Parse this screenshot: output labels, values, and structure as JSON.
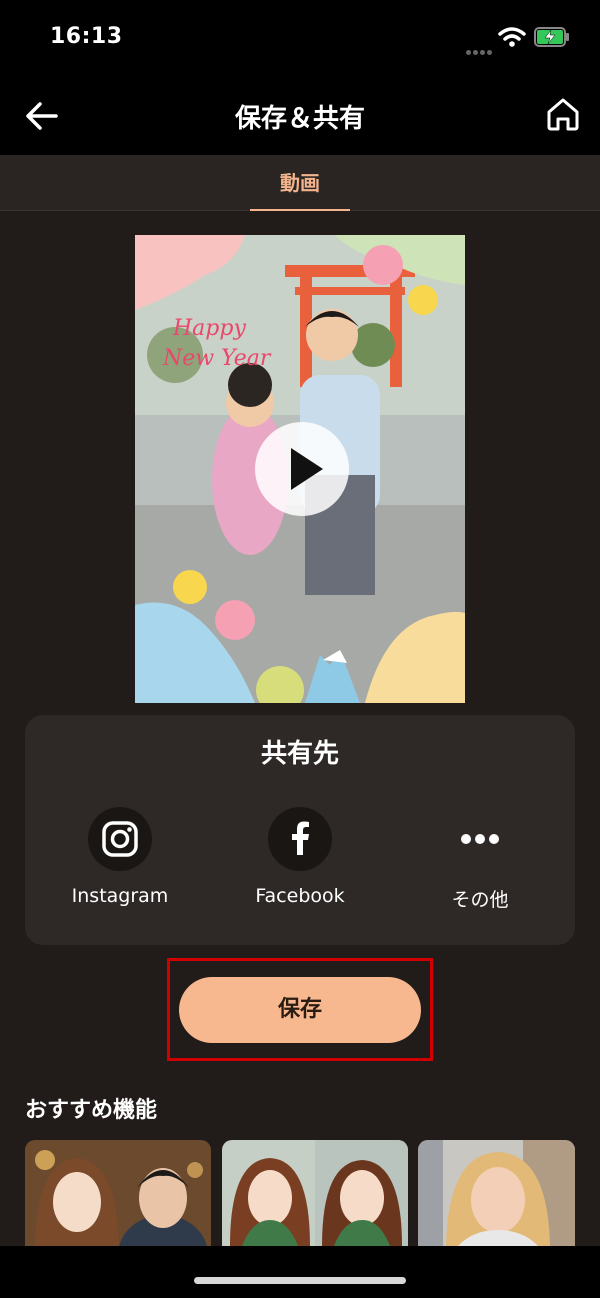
{
  "status_bar": {
    "time": "16:13"
  },
  "nav": {
    "title": "保存＆共有"
  },
  "tabs": [
    {
      "label": "動画",
      "active": true
    }
  ],
  "preview": {
    "greeting_line1": "Happy",
    "greeting_line2": "New Year"
  },
  "share": {
    "title": "共有先",
    "items": [
      {
        "label": "Instagram",
        "icon": "instagram-icon"
      },
      {
        "label": "Facebook",
        "icon": "facebook-icon"
      },
      {
        "label": "その他",
        "icon": "more-icon"
      }
    ]
  },
  "save": {
    "label": "保存"
  },
  "recommended": {
    "title": "おすすめ機能",
    "cards": [
      {
        "name": "portrait-couple"
      },
      {
        "name": "anime-style-women"
      },
      {
        "name": "woman-portrait"
      }
    ]
  },
  "colors": {
    "accent": "#f3b48d",
    "save_button": "#f8b88f",
    "highlight": "#d10000",
    "background": "#211c1a"
  }
}
